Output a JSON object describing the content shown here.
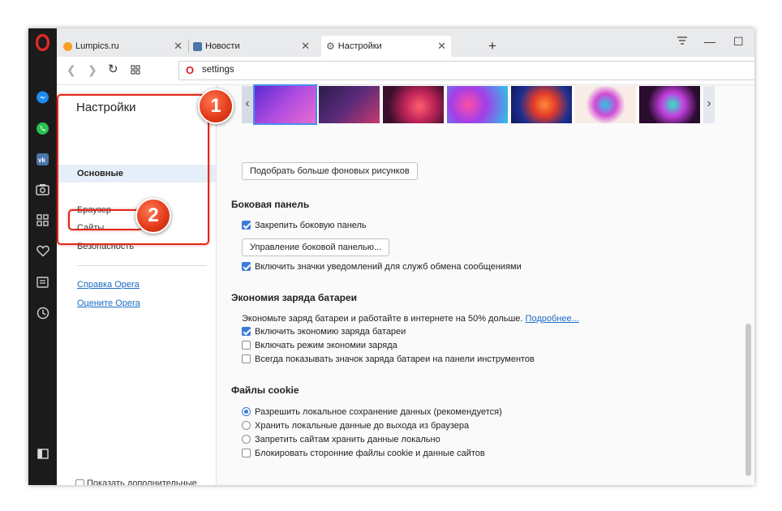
{
  "tabs": [
    {
      "label": "Lumpics.ru",
      "icon": "lumpics-favicon-icon"
    },
    {
      "label": "Новости",
      "icon": "vk-favicon-icon"
    },
    {
      "label": "Настройки",
      "icon": "gear-icon"
    }
  ],
  "address": {
    "url": "settings"
  },
  "sidebar": {
    "title": "Настройки",
    "items": [
      "Основные",
      "Браузер",
      "Сайты",
      "Безопасность"
    ],
    "links": [
      "Справка Opera",
      "Оцените Opera"
    ],
    "advanced_label": "Показать дополнительные настройки"
  },
  "main": {
    "more_backgrounds_button": "Подобрать больше фоновых рисунков",
    "sidebar_panel": {
      "heading": "Боковая панель",
      "pin_label": "Закрепить боковую панель",
      "manage_button": "Управление боковой панелью...",
      "notify_label": "Включить значки уведомлений для служб обмена сообщениями"
    },
    "battery": {
      "heading": "Экономия заряда батареи",
      "description": "Экономьте заряд батареи и работайте в интернете на 50% дольше.",
      "more_link": "Подробнее...",
      "options": [
        {
          "label": "Включить экономию заряда батареи",
          "checked": true
        },
        {
          "label": "Включать режим экономии заряда",
          "checked": false
        },
        {
          "label": "Всегда показывать значок заряда батареи на панели инструментов",
          "checked": false
        }
      ]
    },
    "cookies": {
      "heading": "Файлы cookie",
      "radios": [
        {
          "label": "Разрешить локальное сохранение данных (рекомендуется)",
          "selected": true
        },
        {
          "label": "Хранить локальные данные до выхода из браузера",
          "selected": false
        },
        {
          "label": "Запретить сайтам хранить данные локально",
          "selected": false
        }
      ],
      "block_third_party_label": "Блокировать сторонние файлы cookie и данные сайтов"
    }
  },
  "annotations": {
    "badge1": "1",
    "badge2": "2"
  },
  "colors": {
    "accent": "#3b7bd8",
    "annotation_red": "#e0271b",
    "opera_red": "#d3232a"
  }
}
